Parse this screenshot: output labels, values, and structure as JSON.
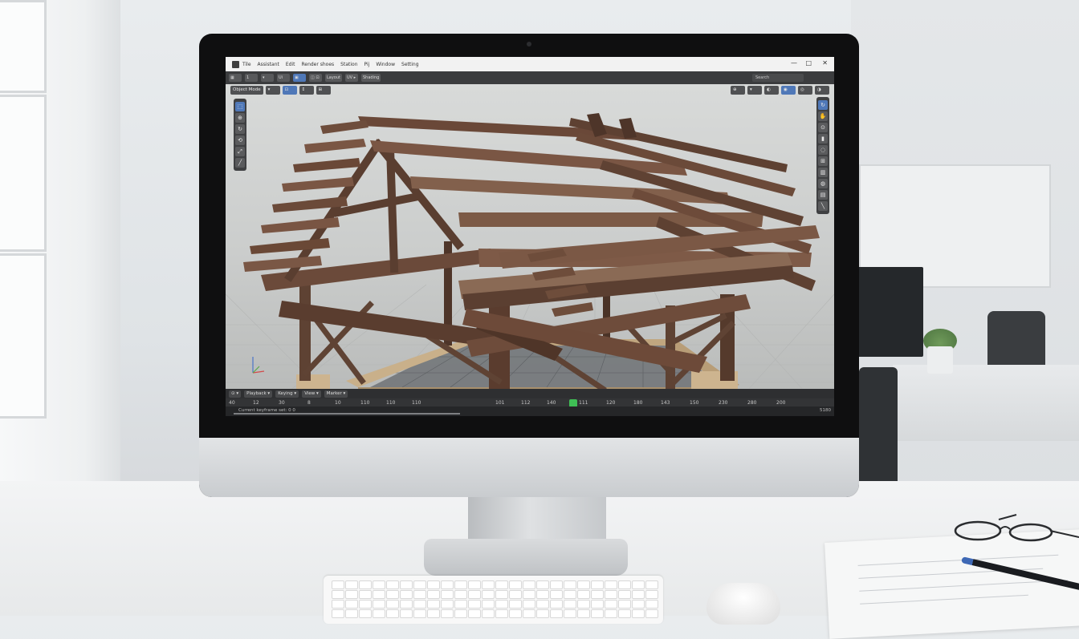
{
  "menubar": {
    "items": [
      "Tile",
      "Assistant",
      "Edit",
      "Render shoes",
      "Station",
      "Pij",
      "Window",
      "Setting"
    ],
    "window_controls": [
      "—",
      "□",
      "✕"
    ]
  },
  "toolbar": {
    "buttons": [
      "▦",
      "1",
      "▾",
      "Ui",
      "▣",
      "◫ ⊡",
      "Layout",
      "UV ▸",
      "Shading"
    ],
    "search_placeholder": "Search"
  },
  "viewport": {
    "header": [
      "Object Mode",
      "▾",
      "⊡",
      "↕",
      "⊞"
    ],
    "right_header": [
      "⊕",
      "▾",
      "◐",
      "◉",
      "◎",
      "◑"
    ],
    "left_tools": [
      "⬚",
      "⊕",
      "↻",
      "⟲",
      "⤢",
      "╱"
    ],
    "right_tools": [
      "↻",
      "✋",
      "⊙",
      "▮",
      "◌",
      "⊞",
      "▥",
      "◍",
      "▤",
      "╲"
    ]
  },
  "timeline": {
    "header": [
      "⊙ ▾",
      "Playback ▾",
      "Keying ▾",
      "View ▾",
      "Marker ▾"
    ],
    "ticks": [
      "40",
      "12",
      "30",
      "8",
      "10",
      "110",
      "110",
      "110",
      "101",
      "112",
      "140",
      "111",
      "120",
      "180",
      "143",
      "150",
      "230",
      "280",
      "200"
    ],
    "current_frame": "111"
  },
  "status": {
    "text": "Current keyframe set: 0 0",
    "right": "5180"
  },
  "colors": {
    "timber_dark": "#4a3226",
    "timber_mid": "#6b4a3a",
    "timber_light": "#8a6a55",
    "accent_blue": "#4f78b8",
    "playhead_green": "#3fbf55"
  }
}
